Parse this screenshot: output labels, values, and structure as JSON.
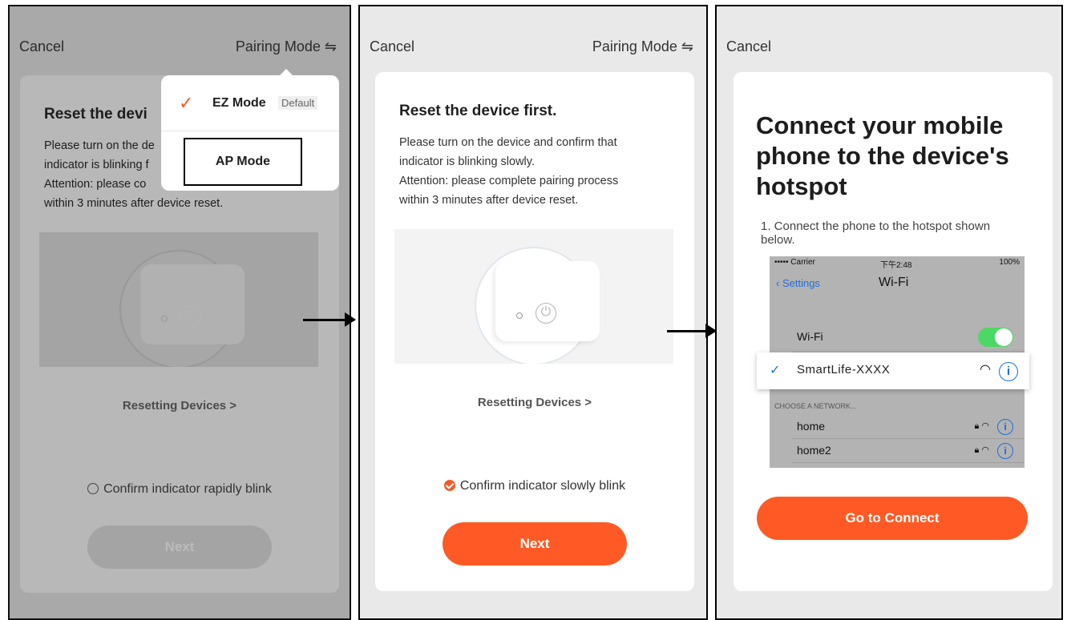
{
  "panel1": {
    "cancel": "Cancel",
    "pairing_mode": "Pairing Mode ⇋",
    "title": "Reset the devi",
    "desc": [
      "Please turn on the de",
      "indicator is blinking f",
      "Attention: please co",
      "within 3 minutes after device reset."
    ],
    "dropdown": {
      "check": "✓",
      "ez_mode": "EZ Mode",
      "default_badge": "Default",
      "ap_mode": "AP Mode"
    },
    "resetting": "Resetting Devices >",
    "confirm": "Confirm indicator rapidly blink",
    "next": "Next"
  },
  "panel2": {
    "cancel": "Cancel",
    "pairing_mode": "Pairing Mode ⇋",
    "title": "Reset the device first.",
    "desc": [
      "Please turn on the device and confirm that",
      "indicator is blinking slowly.",
      "Attention: please complete pairing process",
      "within 3 minutes after device reset."
    ],
    "resetting": "Resetting Devices >",
    "confirm": "Confirm indicator slowly blink",
    "next": "Next"
  },
  "panel3": {
    "cancel": "Cancel",
    "heading": "Connect your mobile phone to the device's hotspot",
    "step": "1. Connect the phone to the hotspot shown below.",
    "wifi_screen": {
      "carrier": "••••• Carrier",
      "time": "下午2:48",
      "battery": "100%",
      "back": "Settings",
      "title": "Wi-Fi",
      "wifi_label": "Wi-Fi",
      "selected_network": "SmartLife-XXXX",
      "choose_label": "CHOOSE A NETWORK...",
      "networks": [
        "home",
        "home2"
      ]
    },
    "go_button": "Go to Connect"
  },
  "icons": {
    "power": "power-icon",
    "wifi": "wifi-icon",
    "lock": "lock-icon",
    "info": "info-icon",
    "check": "check-icon"
  }
}
